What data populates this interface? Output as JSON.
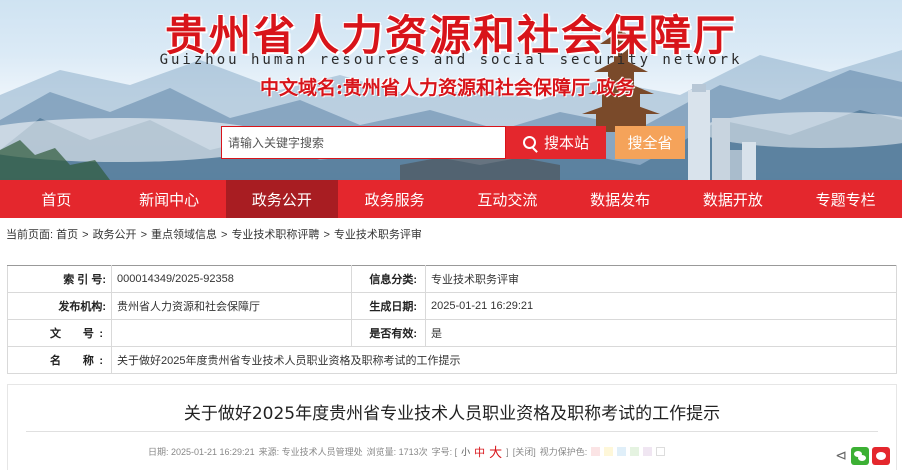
{
  "banner": {
    "title": "贵州省人力资源和社会保障厅",
    "subtitle": "Guizhou human resources and social security network",
    "domain_name": "中文域名:贵州省人力资源和社会保障厅.政务"
  },
  "search": {
    "placeholder": "请输入关键字搜索",
    "search_button": "搜本站",
    "province_button": "搜全省"
  },
  "nav": {
    "items": [
      {
        "label": "首页"
      },
      {
        "label": "新闻中心"
      },
      {
        "label": "政务公开",
        "active": true
      },
      {
        "label": "政务服务"
      },
      {
        "label": "互动交流"
      },
      {
        "label": "数据发布"
      },
      {
        "label": "数据开放"
      },
      {
        "label": "专题专栏"
      }
    ]
  },
  "breadcrumb": {
    "prefix": "当前页面:",
    "items": [
      "首页",
      "政务公开",
      "重点领域信息",
      "专业技术职称评聘",
      "专业技术职务评审"
    ],
    "separator": ">"
  },
  "info": {
    "index_label": "索 引 号:",
    "index_value": "000014349/2025-92358",
    "category_label": "信息分类:",
    "category_value": "专业技术职务评审",
    "publisher_label": "发布机构:",
    "publisher_value": "贵州省人力资源和社会保障厅",
    "date_label": "生成日期:",
    "date_value": "2025-01-21 16:29:21",
    "docno_label": "文　号:",
    "docno_value": "",
    "valid_label": "是否有效:",
    "valid_value": "是",
    "name_label": "名　称:",
    "name_value": "关于做好2025年度贵州省专业技术人员职业资格及职称考试的工作提示"
  },
  "article": {
    "title": "关于做好2025年度贵州省专业技术人员职业资格及职称考试的工作提示",
    "date": "日期: 2025-01-21 16:29:21",
    "source": "来源: 专业技术人员管理处",
    "views": "浏览量: 1713次",
    "font_label": "字号: [",
    "font_small": "小",
    "font_mid": "中",
    "font_big": "大",
    "font_end": "]",
    "close": "[关闭]",
    "eye_protect": "视力保护色:",
    "swatches": [
      "#fbe4e5",
      "#fef7d9",
      "#e0eff9",
      "#e5f3e1",
      "#f0e6f2",
      "#ffffff"
    ]
  },
  "colors": {
    "brand_red": "#e4272d",
    "active_nav": "#a81d22",
    "province_button": "#f5a35a"
  }
}
